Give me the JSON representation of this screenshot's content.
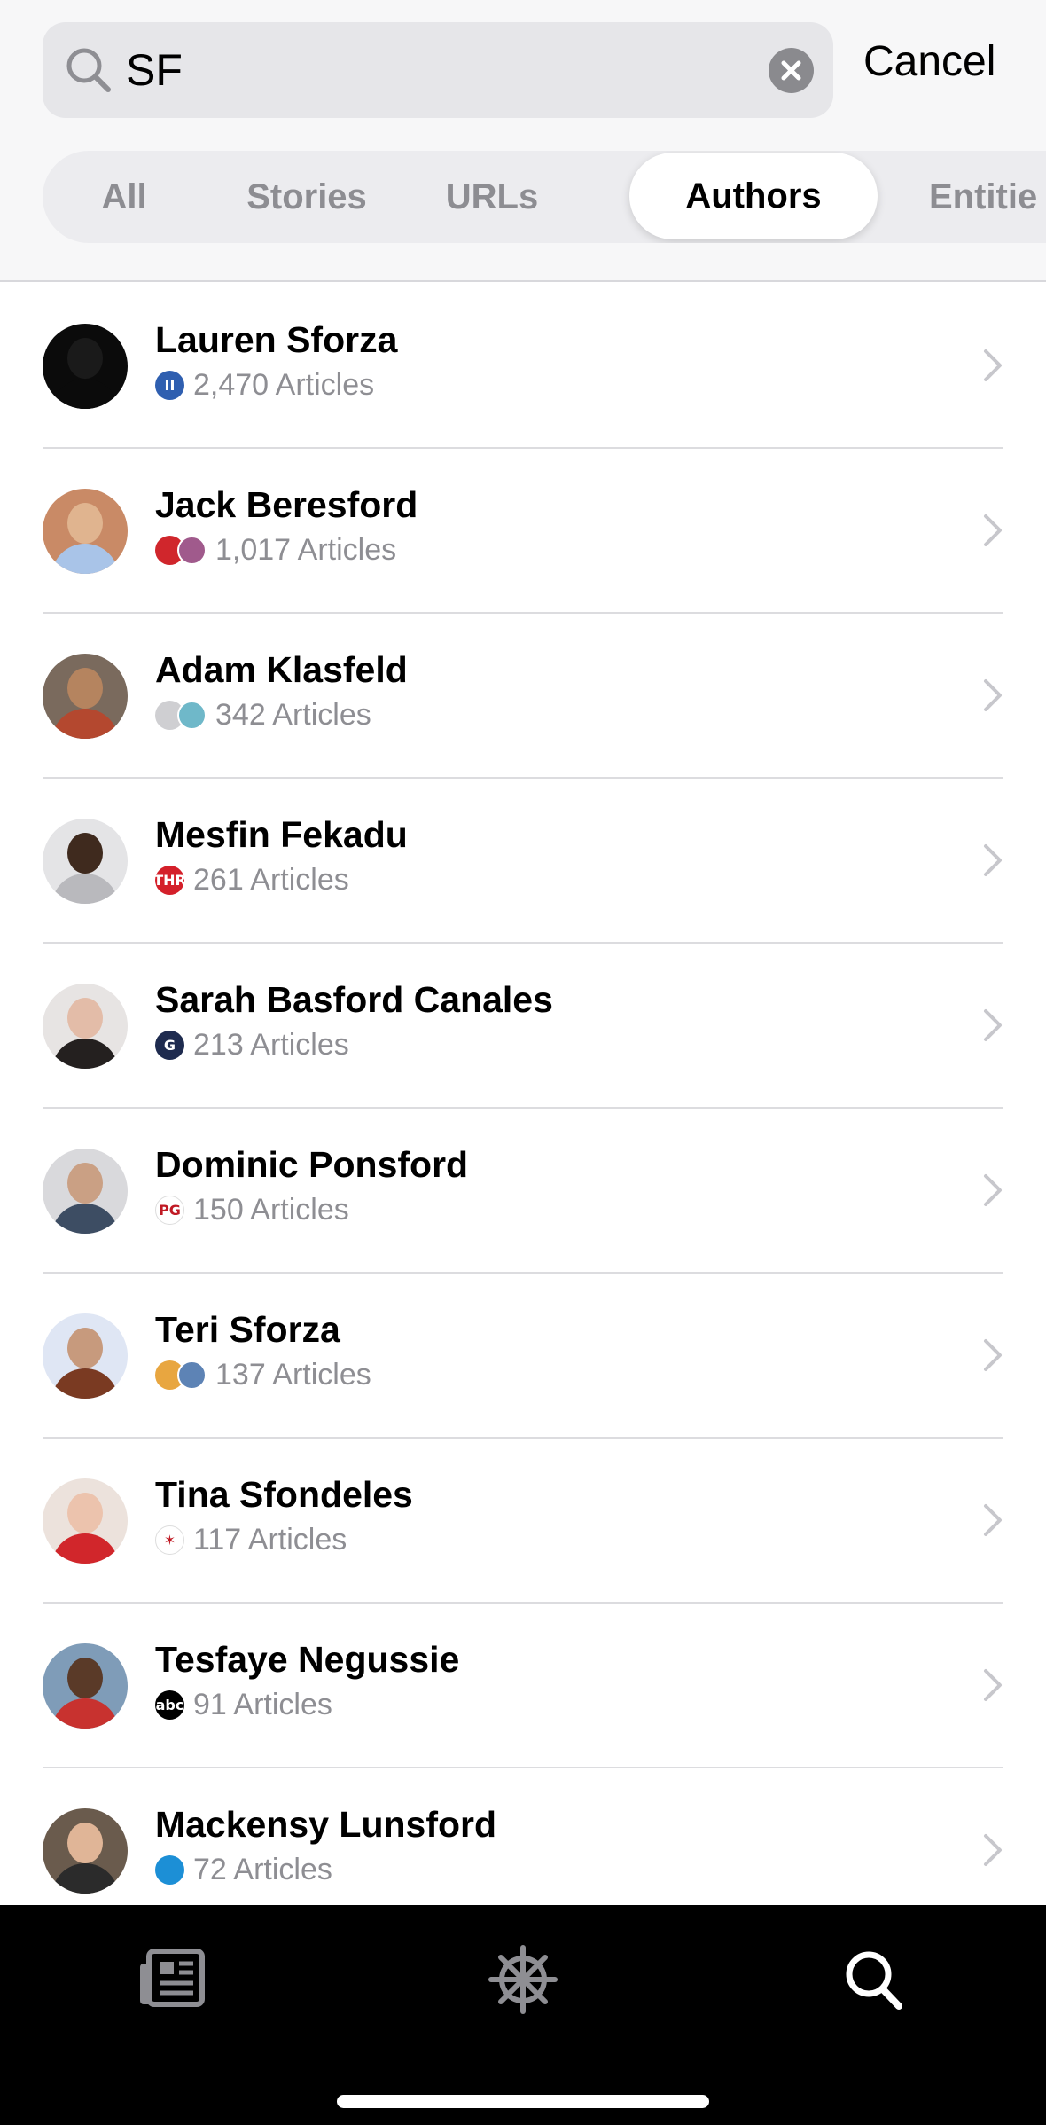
{
  "search": {
    "value": "SF",
    "cancel_label": "Cancel"
  },
  "tabs": [
    {
      "label": "All"
    },
    {
      "label": "Stories"
    },
    {
      "label": "URLs"
    },
    {
      "label": "Authors",
      "active": true
    },
    {
      "label": "Entitie"
    }
  ],
  "authors": [
    {
      "name": "Lauren Sforza",
      "articles": "2,470 Articles",
      "logo_colors": [
        "#2f5fb0"
      ],
      "logo_glyphs": [
        "II"
      ]
    },
    {
      "name": "Jack Beresford",
      "articles": "1,017 Articles",
      "logo_colors": [
        "#d0262c",
        "#a05a8c"
      ],
      "logo_glyphs": [
        "",
        ""
      ]
    },
    {
      "name": "Adam Klasfeld",
      "articles": "342 Articles",
      "logo_colors": [
        "#cfcfd2",
        "#6fb8c9"
      ],
      "logo_glyphs": [
        "",
        ""
      ]
    },
    {
      "name": "Mesfin Fekadu",
      "articles": "261 Articles",
      "logo_colors": [
        "#d4202a"
      ],
      "logo_glyphs": [
        "THR"
      ]
    },
    {
      "name": "Sarah Basford Canales",
      "articles": "213 Articles",
      "logo_colors": [
        "#1e2b4f"
      ],
      "logo_glyphs": [
        "G"
      ]
    },
    {
      "name": "Dominic Ponsford",
      "articles": "150 Articles",
      "logo_colors": [
        "#ffffff"
      ],
      "logo_glyphs": [
        "PG"
      ]
    },
    {
      "name": "Teri Sforza",
      "articles": "137 Articles",
      "logo_colors": [
        "#e8a640",
        "#5d83b5"
      ],
      "logo_glyphs": [
        "",
        ""
      ]
    },
    {
      "name": "Tina Sfondeles",
      "articles": "117 Articles",
      "logo_colors": [
        "#ffffff"
      ],
      "logo_glyphs": [
        "✶"
      ]
    },
    {
      "name": "Tesfaye Negussie",
      "articles": "91 Articles",
      "logo_colors": [
        "#000000"
      ],
      "logo_glyphs": [
        "abc"
      ]
    },
    {
      "name": "Mackensy Lunsford",
      "articles": "72 Articles",
      "logo_colors": [
        "#1c8fd6"
      ],
      "logo_glyphs": [
        ""
      ]
    }
  ],
  "avatars": [
    {
      "bg": "#0b0b0b",
      "head": "#1a1a1a",
      "body": "#0b0b0b"
    },
    {
      "bg": "#c98a66",
      "head": "#e0b48f",
      "body": "#a9c4e8"
    },
    {
      "bg": "#7a6a5d",
      "head": "#b5845f",
      "body": "#b4482f"
    },
    {
      "bg": "#e4e4e6",
      "head": "#3f2a1e",
      "body": "#b9b9bd"
    },
    {
      "bg": "#e7e4e3",
      "head": "#e3bca8",
      "body": "#24201f"
    },
    {
      "bg": "#d9d9dc",
      "head": "#caa084",
      "body": "#3d4d63"
    },
    {
      "bg": "#dfe6f4",
      "head": "#c79a7d",
      "body": "#7a3a22"
    },
    {
      "bg": "#ece2dc",
      "head": "#ecc3ad",
      "body": "#d1262b"
    },
    {
      "bg": "#7f9cb8",
      "head": "#5a3a28",
      "body": "#c8322f"
    },
    {
      "bg": "#6a5b4d",
      "head": "#e0b597",
      "body": "#2b2b2b"
    }
  ],
  "tabbar": {
    "items": [
      {
        "icon": "news-feed-icon",
        "color": "#8e8e93"
      },
      {
        "icon": "helm-icon",
        "color": "#8e8e93"
      },
      {
        "icon": "search-icon",
        "color": "#ffffff"
      }
    ]
  },
  "colors": {
    "accent_text": "#000000",
    "secondary_text": "#8e8e93",
    "background": "#f7f7f8"
  }
}
